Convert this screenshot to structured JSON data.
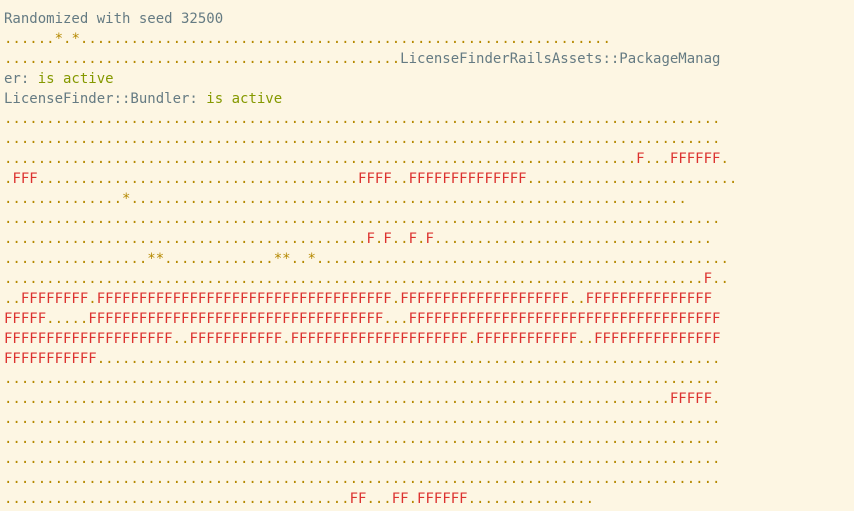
{
  "colors": {
    "background": "#fdf6e3",
    "text": "#657b83",
    "pass_dot": "#b58900",
    "pending_star": "#b58900",
    "failure_F": "#dc322f",
    "active_green": "#859900"
  },
  "terminal": {
    "lines": [
      {
        "segments": [
          {
            "c": "text",
            "t": "Randomized with seed 32500"
          }
        ]
      },
      {
        "segments": [
          {
            "c": "dot",
            "t": "......"
          },
          {
            "c": "pend",
            "t": "*"
          },
          {
            "c": "dot",
            "t": "."
          },
          {
            "c": "pend",
            "t": "*"
          },
          {
            "c": "dot",
            "t": "..............................................................."
          }
        ]
      },
      {
        "segments": [
          {
            "c": "dot",
            "t": "..............................................."
          },
          {
            "c": "text",
            "t": "LicenseFinderRailsAssets::PackageManag"
          }
        ]
      },
      {
        "segments": [
          {
            "c": "text",
            "t": "er: "
          },
          {
            "c": "green",
            "t": "is active"
          }
        ]
      },
      {
        "segments": [
          {
            "c": "text",
            "t": "LicenseFinder::Bundler: "
          },
          {
            "c": "green",
            "t": "is active"
          }
        ]
      },
      {
        "segments": [
          {
            "c": "dot",
            "t": "....................................................................................."
          }
        ]
      },
      {
        "segments": [
          {
            "c": "dot",
            "t": "....................................................................................."
          }
        ]
      },
      {
        "segments": [
          {
            "c": "dot",
            "t": "..........................................................................."
          },
          {
            "c": "fail",
            "t": "F"
          },
          {
            "c": "dot",
            "t": "..."
          },
          {
            "c": "fail",
            "t": "FFFFFF"
          },
          {
            "c": "dot",
            "t": "."
          }
        ]
      },
      {
        "segments": [
          {
            "c": "dot",
            "t": "."
          },
          {
            "c": "fail",
            "t": "FFF"
          },
          {
            "c": "dot",
            "t": "......................................"
          },
          {
            "c": "fail",
            "t": "FFFF"
          },
          {
            "c": "dot",
            "t": ".."
          },
          {
            "c": "fail",
            "t": "FFFFFFFFFFFFFF"
          },
          {
            "c": "dot",
            "t": "........................."
          }
        ]
      },
      {
        "segments": [
          {
            "c": "dot",
            "t": ".............."
          },
          {
            "c": "pend",
            "t": "*"
          },
          {
            "c": "dot",
            "t": ".................................................................."
          }
        ]
      },
      {
        "segments": [
          {
            "c": "dot",
            "t": "....................................................................................."
          }
        ]
      },
      {
        "segments": [
          {
            "c": "dot",
            "t": "..........................................."
          },
          {
            "c": "fail",
            "t": "F"
          },
          {
            "c": "dot",
            "t": "."
          },
          {
            "c": "fail",
            "t": "F"
          },
          {
            "c": "dot",
            "t": ".."
          },
          {
            "c": "fail",
            "t": "F"
          },
          {
            "c": "dot",
            "t": "."
          },
          {
            "c": "fail",
            "t": "F"
          },
          {
            "c": "dot",
            "t": "................................."
          }
        ]
      },
      {
        "segments": [
          {
            "c": "dot",
            "t": "................."
          },
          {
            "c": "pend",
            "t": "**"
          },
          {
            "c": "dot",
            "t": "............."
          },
          {
            "c": "pend",
            "t": "**"
          },
          {
            "c": "dot",
            "t": ".."
          },
          {
            "c": "pend",
            "t": "*"
          },
          {
            "c": "dot",
            "t": "................................................."
          }
        ]
      },
      {
        "segments": [
          {
            "c": "dot",
            "t": "..................................................................................."
          },
          {
            "c": "fail",
            "t": "F"
          },
          {
            "c": "dot",
            "t": ".."
          }
        ]
      },
      {
        "segments": [
          {
            "c": "dot",
            "t": ".."
          },
          {
            "c": "fail",
            "t": "FFFFFFFF"
          },
          {
            "c": "dot",
            "t": "."
          },
          {
            "c": "fail",
            "t": "FFFFFFFFFFFFFFFFFFFFFFFFFFFFFFFFFFF"
          },
          {
            "c": "dot",
            "t": "."
          },
          {
            "c": "fail",
            "t": "FFFFFFFFFFFFFFFFFFFF"
          },
          {
            "c": "dot",
            "t": ".."
          },
          {
            "c": "fail",
            "t": "FFFFFFFFFFFFFFF"
          }
        ]
      },
      {
        "segments": [
          {
            "c": "fail",
            "t": "FFFFF"
          },
          {
            "c": "dot",
            "t": "....."
          },
          {
            "c": "fail",
            "t": "FFFFFFFFFFFFFFFFFFFFFFFFFFFFFFFFFFF"
          },
          {
            "c": "dot",
            "t": "..."
          },
          {
            "c": "fail",
            "t": "FFFFFFFFFFFFFFFFFFFFFFFFFFFFFFFFFFFFF"
          }
        ]
      },
      {
        "segments": [
          {
            "c": "fail",
            "t": "FFFFFFFFFFFFFFFFFFFF"
          },
          {
            "c": "dot",
            "t": ".."
          },
          {
            "c": "fail",
            "t": "FFFFFFFFFFF"
          },
          {
            "c": "dot",
            "t": "."
          },
          {
            "c": "fail",
            "t": "FFFFFFFFFFFFFFFFFFFFF"
          },
          {
            "c": "dot",
            "t": "."
          },
          {
            "c": "fail",
            "t": "FFFFFFFFFFFF"
          },
          {
            "c": "dot",
            "t": ".."
          },
          {
            "c": "fail",
            "t": "FFFFFFFFFFFFFFF"
          }
        ]
      },
      {
        "segments": [
          {
            "c": "fail",
            "t": "FFFFFFFFFFF"
          },
          {
            "c": "dot",
            "t": ".........................................................................."
          }
        ]
      },
      {
        "segments": [
          {
            "c": "dot",
            "t": "....................................................................................."
          }
        ]
      },
      {
        "segments": [
          {
            "c": "dot",
            "t": "..............................................................................."
          },
          {
            "c": "fail",
            "t": "FFFFF"
          },
          {
            "c": "dot",
            "t": "."
          }
        ]
      },
      {
        "segments": [
          {
            "c": "dot",
            "t": "....................................................................................."
          }
        ]
      },
      {
        "segments": [
          {
            "c": "dot",
            "t": "....................................................................................."
          }
        ]
      },
      {
        "segments": [
          {
            "c": "dot",
            "t": "....................................................................................."
          }
        ]
      },
      {
        "segments": [
          {
            "c": "dot",
            "t": "....................................................................................."
          }
        ]
      },
      {
        "segments": [
          {
            "c": "dot",
            "t": "........................................."
          },
          {
            "c": "fail",
            "t": "FF"
          },
          {
            "c": "dot",
            "t": "..."
          },
          {
            "c": "fail",
            "t": "FF"
          },
          {
            "c": "dot",
            "t": "."
          },
          {
            "c": "fail",
            "t": "FFFFFF"
          },
          {
            "c": "dot",
            "t": "..............."
          }
        ]
      }
    ]
  }
}
